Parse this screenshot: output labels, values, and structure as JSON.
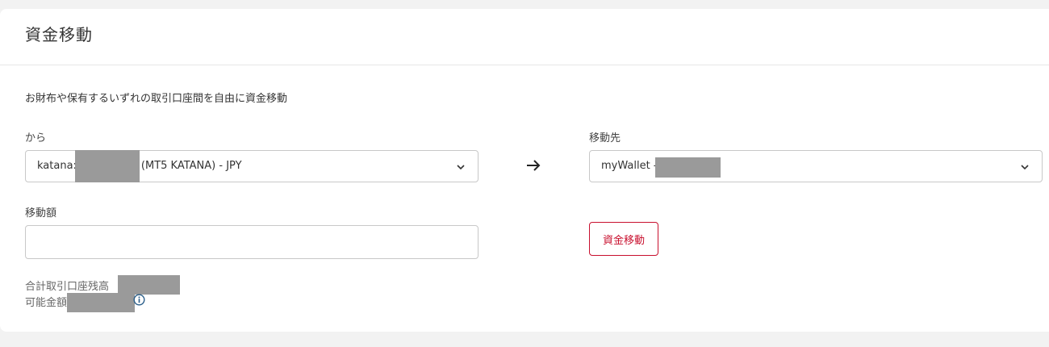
{
  "header": {
    "title": "資金移動"
  },
  "description": "お財布や保有するいずれの取引口座間を自由に資金移動",
  "from": {
    "label": "から",
    "value_prefix": "katana:",
    "value_suffix": "(MT5 KATANA) - JPY"
  },
  "to": {
    "label": "移動先",
    "value_prefix": "myWallet -"
  },
  "amount": {
    "label": "移動額",
    "value": "",
    "placeholder": ""
  },
  "transfer_button": "資金移動",
  "balance": {
    "total_label": "合計取引口座残高",
    "available_label": "可能金額"
  },
  "icons": {
    "arrow": "arrow-right-icon",
    "chevron": "chevron-down-icon",
    "info": "info-icon"
  },
  "colors": {
    "accent": "#c8102e",
    "redaction": "#9a9a9a"
  }
}
